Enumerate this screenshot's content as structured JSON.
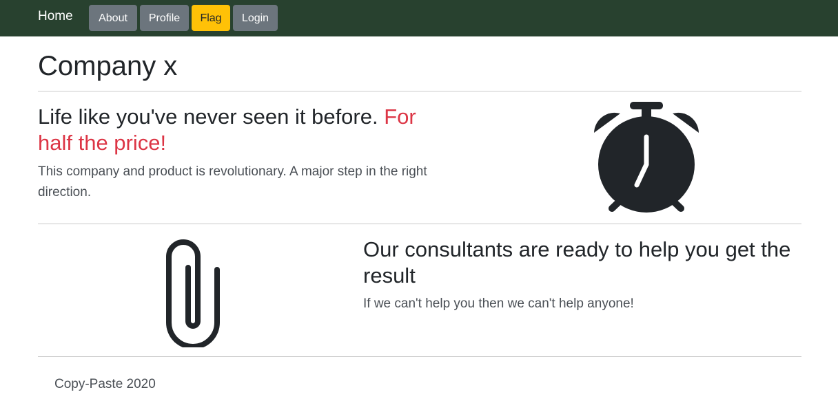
{
  "navbar": {
    "brand": "Home",
    "buttons": [
      {
        "label": "About",
        "color": "#6c757d"
      },
      {
        "label": "Profile",
        "color": "#6c757d"
      },
      {
        "label": "Flag",
        "color": "#ffc107"
      },
      {
        "label": "Login",
        "color": "#6c757d"
      }
    ],
    "background": "#28412f"
  },
  "page": {
    "title": "Company x"
  },
  "feature1": {
    "heading_main": "Life like you've never seen it before. ",
    "heading_accent": "For half the price!",
    "accent_color": "#dc3545",
    "text": "This company and product is revolutionary. A major step in the right direction.",
    "icon": "alarm-clock-icon"
  },
  "feature2": {
    "heading": "Our consultants are ready to help you get the result",
    "text": "If we can't help you then we can't help anyone!",
    "icon": "paperclip-icon"
  },
  "footer": {
    "text": "Copy-Paste 2020"
  }
}
